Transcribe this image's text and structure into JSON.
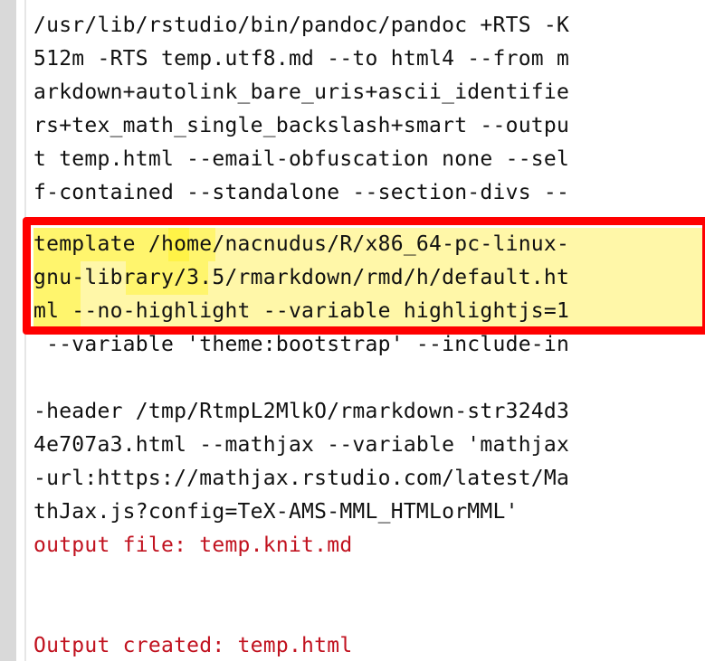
{
  "console": {
    "lines": [
      {
        "text": "/usr/lib/rstudio/bin/pandoc/pandoc +RTS -K"
      },
      {
        "text": "512m -RTS temp.utf8.md --to html4 --from m"
      },
      {
        "text": "arkdown+autolink_bare_uris+ascii_identifie"
      },
      {
        "text": "rs+tex_math_single_backslash+smart --outpu"
      },
      {
        "text": "t temp.html --email-obfuscation none --sel"
      },
      {
        "text": "f-contained --standalone --section-divs --"
      },
      {
        "text": "template /home/nacnudus/R/x86_64-pc-linux-"
      },
      {
        "text": "gnu-library/3.5/rmarkdown/rmd/h/default.ht"
      },
      {
        "text": "ml --no-highlight --variable highlightjs=1"
      },
      {
        "text": " --variable 'theme:bootstrap' --include-in"
      },
      {
        "text": "-header /tmp/RtmpL2MlkO/rmarkdown-str324d3"
      },
      {
        "text": "4e707a3.html --mathjax --variable 'mathjax"
      },
      {
        "text": "-url:https://mathjax.rstudio.com/latest/Ma"
      },
      {
        "text": "thJax.js?config=TeX-AMS-MML_HTMLorMML'"
      },
      {
        "text": "output file: temp.knit.md"
      },
      {
        "text": ""
      },
      {
        "text": ""
      },
      {
        "text": "Output created: temp.html"
      }
    ],
    "colors": {
      "normal": "#111111",
      "message": "#c1121f",
      "highlight": "#fff7a8",
      "annotation_box": "#ff0000"
    }
  }
}
